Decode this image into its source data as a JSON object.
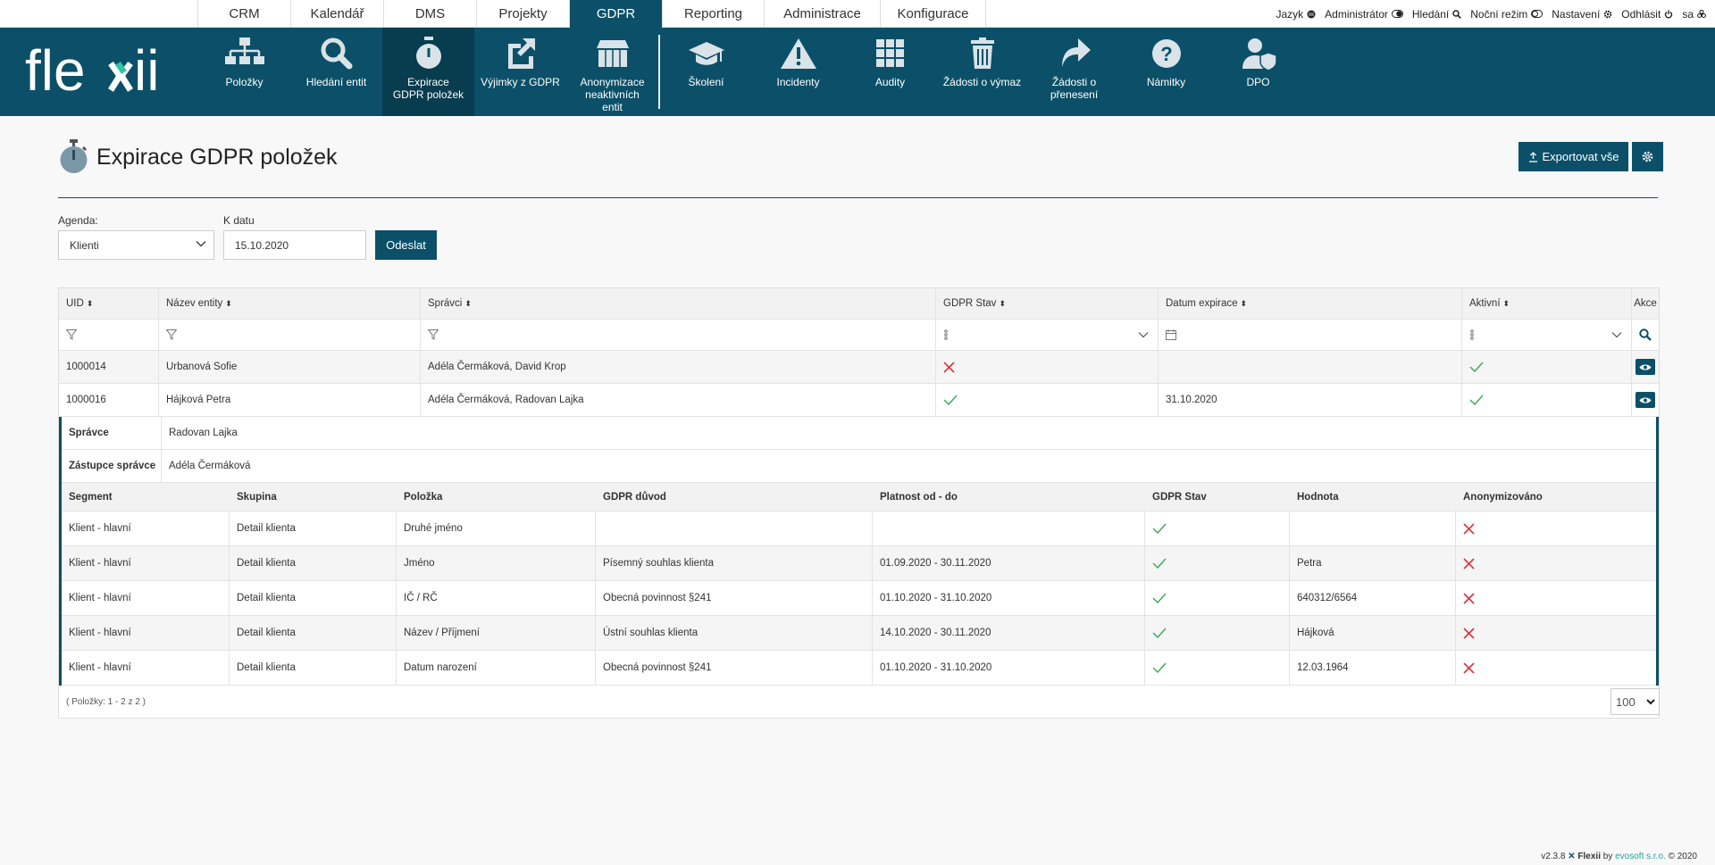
{
  "top_tabs": [
    {
      "label": "CRM",
      "active": false,
      "w": 104
    },
    {
      "label": "Kalendář",
      "active": false,
      "w": 104
    },
    {
      "label": "DMS",
      "active": false,
      "w": 104
    },
    {
      "label": "Projekty",
      "active": false,
      "w": 104
    },
    {
      "label": "GDPR",
      "active": true,
      "w": 104
    },
    {
      "label": "Reporting",
      "active": false,
      "w": 114
    },
    {
      "label": "Administrace",
      "active": false,
      "w": 130
    },
    {
      "label": "Konfigurace",
      "active": false,
      "w": 119
    }
  ],
  "top_right": {
    "language": "Jazyk",
    "user": "Administrátor",
    "search": "Hledání",
    "night": "Noční režim",
    "settings": "Nastavení",
    "logout": "Odhlásit",
    "username": "sa"
  },
  "ribbon": [
    {
      "label": "Položky",
      "icon": "sitemap-icon"
    },
    {
      "label": "Hledání entit",
      "icon": "search-icon"
    },
    {
      "label": "Expirace GDPR položek",
      "icon": "stopwatch-icon",
      "active": true
    },
    {
      "label": "Výjimky z GDPR",
      "icon": "external-link-icon"
    },
    {
      "label": "Anonymizace neaktivních entit",
      "icon": "dumpster-icon"
    },
    {
      "label": "Školení",
      "icon": "graduation-cap-icon"
    },
    {
      "label": "Incidenty",
      "icon": "warning-icon"
    },
    {
      "label": "Audity",
      "icon": "grid-icon"
    },
    {
      "label": "Žádosti o výmaz",
      "icon": "trash-icon"
    },
    {
      "label": "Žádosti o přenesení",
      "icon": "share-icon"
    },
    {
      "label": "Námitky",
      "icon": "question-icon"
    },
    {
      "label": "DPO",
      "icon": "user-shield-icon"
    }
  ],
  "page": {
    "title": "Expirace GDPR položek",
    "export_label": "Exportovat vše"
  },
  "filters": {
    "agenda_label": "Agenda:",
    "agenda_value": "Klienti",
    "date_label": "K datu",
    "date_value": "15.10.2020",
    "submit_label": "Odeslat"
  },
  "grid": {
    "columns": [
      "UID",
      "Název entity",
      "Správci",
      "GDPR Stav",
      "Datum expirace",
      "Aktivní",
      "Akce"
    ],
    "rows": [
      {
        "uid": "1000014",
        "name": "Urbanová Sofie",
        "admins": "Adéla Čermáková, David Krop",
        "gdpr": "no",
        "expiry": "",
        "active": "yes"
      },
      {
        "uid": "1000016",
        "name": "Hájková Petra",
        "admins": "Adéla Čermáková, Radovan Lajka",
        "gdpr": "yes",
        "expiry": "31.10.2020",
        "active": "yes"
      }
    ],
    "footer": "( Položky: 1 - 2 z 2 )",
    "page_size": "100"
  },
  "detail": {
    "admin_label": "Správce",
    "admin_value": "Radovan Lajka",
    "deputy_label": "Zástupce správce",
    "deputy_value": "Adéla Čermáková",
    "columns": [
      "Segment",
      "Skupina",
      "Položka",
      "GDPR důvod",
      "Platnost od - do",
      "GDPR Stav",
      "Hodnota",
      "Anonymizováno"
    ],
    "rows": [
      {
        "segment": "Klient - hlavní",
        "group": "Detail klienta",
        "item": "Druhé jméno",
        "reason": "",
        "validity": "",
        "state": "yes",
        "value": "",
        "anon": "no"
      },
      {
        "segment": "Klient - hlavní",
        "group": "Detail klienta",
        "item": "Jméno",
        "reason": "Písemný souhlas klienta",
        "validity": "01.09.2020 - 30.11.2020",
        "state": "yes",
        "value": "Petra",
        "anon": "no"
      },
      {
        "segment": "Klient - hlavní",
        "group": "Detail klienta",
        "item": "IČ / RČ",
        "reason": "Obecná povinnost §241",
        "validity": "01.10.2020 - 31.10.2020",
        "state": "yes",
        "value": "640312/6564",
        "anon": "no"
      },
      {
        "segment": "Klient - hlavní",
        "group": "Detail klienta",
        "item": "Název / Příjmení",
        "reason": "Ústní souhlas klienta",
        "validity": "14.10.2020 - 30.11.2020",
        "state": "yes",
        "value": "Hájková",
        "anon": "no"
      },
      {
        "segment": "Klient - hlavní",
        "group": "Detail klienta",
        "item": "Datum narození",
        "reason": "Obecná povinnost §241",
        "validity": "01.10.2020 - 31.10.2020",
        "state": "yes",
        "value": "12.03.1964",
        "anon": "no"
      }
    ]
  },
  "version": {
    "version": "v2.3.8",
    "product": "Flexii",
    "by": "by",
    "company": "evosoft s.r.o.",
    "copyright": "© 2020"
  },
  "colors": {
    "brand": "#0b5068",
    "check": "#3aa655",
    "cross": "#d9363e"
  }
}
